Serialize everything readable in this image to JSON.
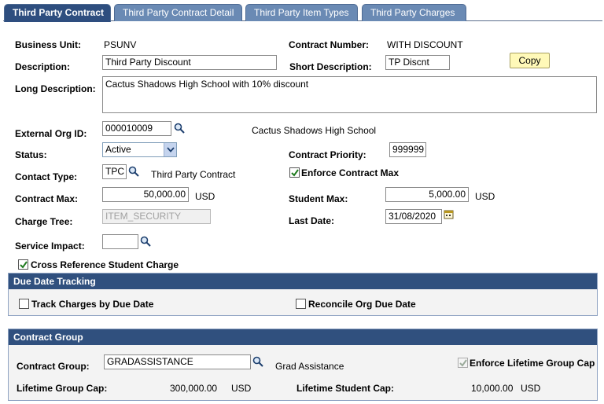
{
  "tabs": [
    {
      "label": "Third Party Contract"
    },
    {
      "label": "Third Party Contract Detail"
    },
    {
      "label": "Third Party Item Types"
    },
    {
      "label": "Third Party Charges"
    }
  ],
  "form": {
    "business_unit_label": "Business Unit:",
    "business_unit_value": "PSUNV",
    "contract_number_label": "Contract Number:",
    "contract_number_value": "WITH DISCOUNT",
    "description_label": "Description:",
    "description_value": "Third Party Discount",
    "short_description_label": "Short Description:",
    "short_description_value": "TP Discnt",
    "copy_button": "Copy",
    "long_description_label": "Long Description:",
    "long_description_value": "Cactus Shadows High School with 10% discount",
    "external_org_label": "External Org ID:",
    "external_org_value": "000010009",
    "external_org_name": "Cactus Shadows High School",
    "status_label": "Status:",
    "status_value": "Active",
    "contract_priority_label": "Contract Priority:",
    "contract_priority_value": "999999",
    "contact_type_label": "Contact Type:",
    "contact_type_value": "TPC",
    "contact_type_desc": "Third Party Contract",
    "enforce_contract_max_label": "Enforce Contract Max",
    "enforce_contract_max_checked": true,
    "contract_max_label": "Contract Max:",
    "contract_max_value": "50,000.00",
    "contract_max_currency": "USD",
    "student_max_label": "Student Max:",
    "student_max_value": "5,000.00",
    "student_max_currency": "USD",
    "charge_tree_label": "Charge Tree:",
    "charge_tree_value": "ITEM_SECURITY",
    "last_date_label": "Last Date:",
    "last_date_value": "31/08/2020",
    "service_impact_label": "Service Impact:",
    "service_impact_value": "",
    "cross_ref_label": "Cross Reference Student Charge",
    "cross_ref_checked": true
  },
  "due_date_tracking": {
    "title": "Due Date Tracking",
    "track_charges_label": "Track Charges by Due Date",
    "track_charges_checked": false,
    "reconcile_label": "Reconcile Org Due Date",
    "reconcile_checked": false
  },
  "contract_group": {
    "title": "Contract Group",
    "group_label": "Contract Group:",
    "group_value": "GRADASSISTANCE",
    "group_desc": "Grad Assistance",
    "enforce_cap_label": "Enforce Lifetime Group Cap",
    "enforce_cap_checked": true,
    "lifetime_group_cap_label": "Lifetime Group Cap:",
    "lifetime_group_cap_value": "300,000.00",
    "lifetime_group_cap_currency": "USD",
    "lifetime_student_cap_label": "Lifetime Student Cap:",
    "lifetime_student_cap_value": "10,000.00",
    "lifetime_student_cap_currency": "USD"
  },
  "colors": {
    "tab_active": "#2e4e7f",
    "tab_inactive": "#6a8ab4",
    "group_header": "#30507e",
    "button_bg": "#fff9b8"
  },
  "icons": {
    "lookup": "magnifier-icon",
    "calendar": "calendar-icon",
    "dropdown": "chevron-down-icon",
    "check": "checkmark-icon"
  }
}
